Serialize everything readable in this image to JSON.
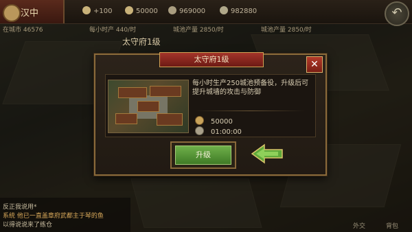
{
  "city": {
    "name": "汉中"
  },
  "resources": [
    {
      "icon": "troop-icon",
      "value": "+100",
      "color": "#c9b27a"
    },
    {
      "icon": "food-icon",
      "value": "50000",
      "color": "#c9b27a"
    },
    {
      "icon": "coin-icon",
      "value": "969000",
      "color": "#a99d80"
    },
    {
      "icon": "wood-icon",
      "value": "982880",
      "color": "#b0a88a"
    }
  ],
  "stats": [
    "在城市 46576",
    "每小时产 440/时",
    "城池产量 2850/时",
    "城池产量 2850/时"
  ],
  "building_label": "太守府1级",
  "dialog": {
    "title": "太守府1级",
    "description": "每小时生产250城池预备役，升级后可提升城墙的攻击与防御",
    "cost": "50000",
    "time": "01:00:00",
    "upgrade_label": "升级",
    "close_label": "✕"
  },
  "chat": [
    "反正我说用*",
    "系统 他已一直盖章府武都主于琴的鱼",
    "以得说说来了练仓"
  ],
  "bottom_nav": [
    "外交",
    "背包"
  ],
  "colors": {
    "accent": "#a3342a",
    "upgrade": "#4f8f30",
    "arrow": "#6fb04a"
  }
}
